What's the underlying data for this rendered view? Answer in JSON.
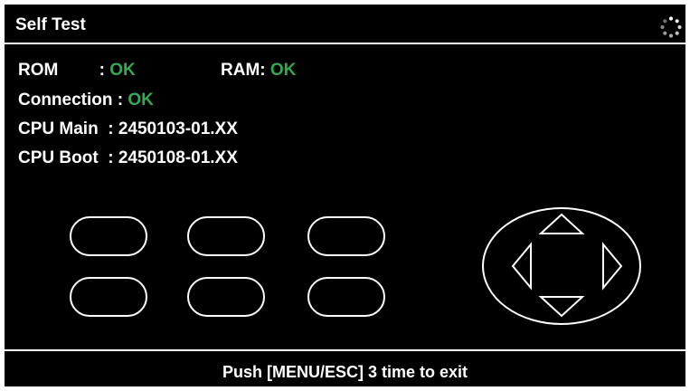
{
  "title": "Self Test",
  "busy_icon": "spinner-icon",
  "rom": {
    "label": "ROM",
    "separator": " : ",
    "value": "OK"
  },
  "ram": {
    "label": "RAM: ",
    "value": "OK"
  },
  "connection": {
    "label": "Connection : ",
    "value": "OK"
  },
  "cpu_main": {
    "label": "CPU Main  : ",
    "value": "2450103-01.XX"
  },
  "cpu_boot": {
    "label": "CPU Boot  : ",
    "value": "2450108-01.XX"
  },
  "keypad": {
    "soft_keys": [
      "soft-key-1",
      "soft-key-2",
      "soft-key-3",
      "soft-key-4",
      "soft-key-5",
      "soft-key-6"
    ],
    "arrows": [
      "up-arrow-icon",
      "down-arrow-icon",
      "left-arrow-icon",
      "right-arrow-icon"
    ]
  },
  "footer": {
    "exit_text": "Push [MENU/ESC] 3 time to exit"
  },
  "colors": {
    "background": "#000000",
    "text": "#ffffff",
    "ok": "#35a853"
  }
}
